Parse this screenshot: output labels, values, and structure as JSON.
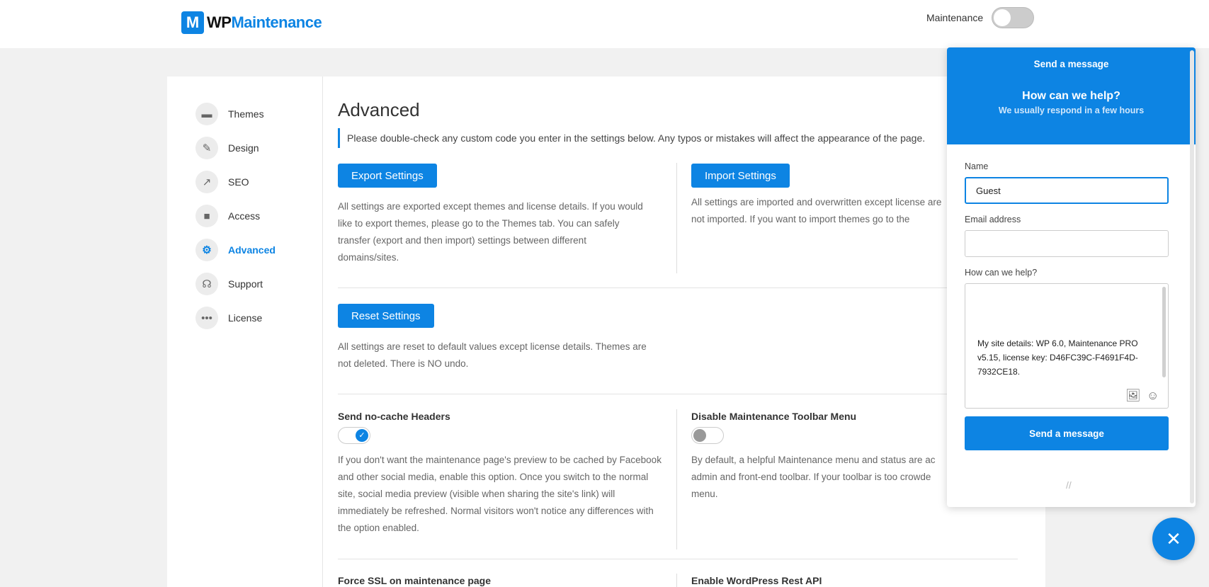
{
  "header": {
    "logo_mark": "M",
    "logo_wp": "WP",
    "logo_maintenance": "Maintenance",
    "maintenance_label": "Maintenance",
    "maintenance_enabled": false
  },
  "sidebar": {
    "items": [
      {
        "label": "Themes",
        "icon": "paint-roller-icon"
      },
      {
        "label": "Design",
        "icon": "brush-icon"
      },
      {
        "label": "SEO",
        "icon": "chart-line-icon"
      },
      {
        "label": "Access",
        "icon": "lock-icon"
      },
      {
        "label": "Advanced",
        "icon": "gear-icon"
      },
      {
        "label": "Support",
        "icon": "headset-icon"
      },
      {
        "label": "License",
        "icon": "dots-icon"
      }
    ],
    "active": "Advanced"
  },
  "main": {
    "title": "Advanced",
    "notice": "Please double-check any custom code you enter in the settings below. Any typos or mistakes will affect the appearance of the page.",
    "export": {
      "button": "Export Settings",
      "desc": "All settings are exported except themes and license details. If you would like to export themes, please go to the Themes tab. You can safely transfer (export and then import) settings between different domains/sites."
    },
    "import": {
      "button": "Import Settings",
      "desc": "All settings are imported and overwritten except license are not imported. If you want to import themes go to the"
    },
    "reset": {
      "button": "Reset Settings",
      "desc": "All settings are reset to default values except license details. Themes are not deleted. There is NO undo."
    },
    "nocache": {
      "title": "Send no-cache Headers",
      "enabled": true,
      "desc": "If you don't want the maintenance page's preview to be cached by Facebook and other social media, enable this option. Once you switch to the normal site, social media preview (visible when sharing the site's link) will immediately be refreshed. Normal visitors won't notice any differences with the option enabled."
    },
    "toolbar": {
      "title": "Disable Maintenance Toolbar Menu",
      "enabled": false,
      "desc": "By default, a helpful Maintenance menu and status are ac admin and front-end toolbar. If your toolbar is too crowde menu."
    },
    "ssl_title": "Force SSL on maintenance page",
    "rest_title": "Enable WordPress Rest API"
  },
  "chat": {
    "header_title": "Send a message",
    "heading": "How can we help?",
    "subheading": "We usually respond in a few hours",
    "name_label": "Name",
    "name_value": "Guest",
    "email_label": "Email address",
    "email_value": "",
    "help_label": "How can we help?",
    "message": "My site details: WP 6.0, Maintenance PRO v5.15, license key: D46FC39C-F4691F4D-7932CE18.",
    "send_button": "Send a message",
    "brand_glyph": "//",
    "close_glyph": "✕"
  }
}
